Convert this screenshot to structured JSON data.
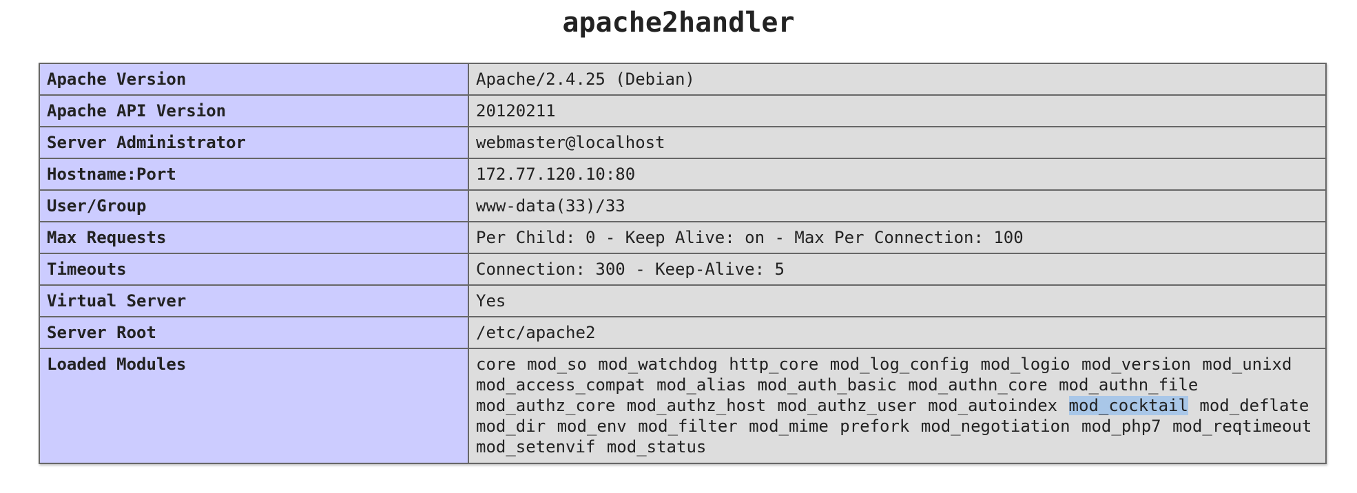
{
  "page": {
    "title": "apache2handler"
  },
  "table": {
    "rows": [
      {
        "key": "Apache Version",
        "value": "Apache/2.4.25 (Debian)"
      },
      {
        "key": "Apache API Version",
        "value": "20120211"
      },
      {
        "key": "Server Administrator",
        "value": "webmaster@localhost"
      },
      {
        "key": "Hostname:Port",
        "value": "172.77.120.10:80"
      },
      {
        "key": "User/Group",
        "value": "www-data(33)/33"
      },
      {
        "key": "Max Requests",
        "value": "Per Child: 0 - Keep Alive: on - Max Per Connection: 100"
      },
      {
        "key": "Timeouts",
        "value": "Connection: 300 - Keep-Alive: 5"
      },
      {
        "key": "Virtual Server",
        "value": "Yes"
      },
      {
        "key": "Server Root",
        "value": "/etc/apache2"
      }
    ],
    "loaded_modules": {
      "key": "Loaded Modules",
      "modules": [
        "core",
        "mod_so",
        "mod_watchdog",
        "http_core",
        "mod_log_config",
        "mod_logio",
        "mod_version",
        "mod_unixd",
        "mod_access_compat",
        "mod_alias",
        "mod_auth_basic",
        "mod_authn_core",
        "mod_authn_file",
        "mod_authz_core",
        "mod_authz_host",
        "mod_authz_user",
        "mod_autoindex",
        "mod_cocktail",
        "mod_deflate",
        "mod_dir",
        "mod_env",
        "mod_filter",
        "mod_mime",
        "prefork",
        "mod_negotiation",
        "mod_php7",
        "mod_reqtimeout",
        "mod_setenvif",
        "mod_status"
      ],
      "selected_module": "mod_cocktail"
    }
  },
  "colors": {
    "key_background": "#ccccff",
    "value_background": "#dddddd",
    "border": "#666666",
    "selection_highlight": "#a9c7e8"
  }
}
